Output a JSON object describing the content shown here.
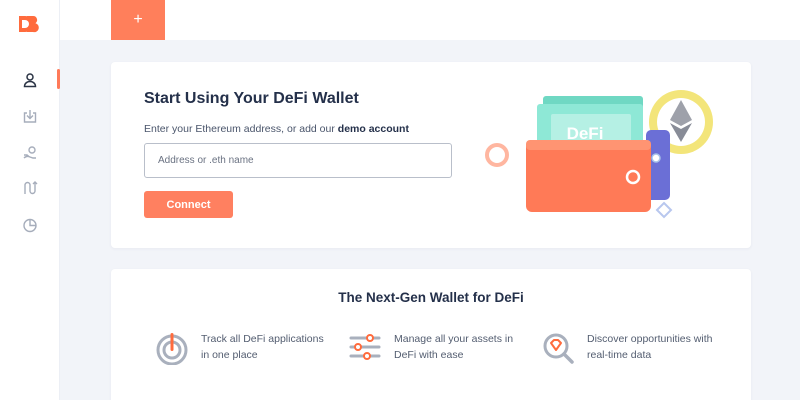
{
  "topbar": {
    "add_tab_label": "+"
  },
  "sidebar": {
    "items": [
      {
        "icon": "user-icon",
        "active": true
      },
      {
        "icon": "download-icon",
        "active": false
      },
      {
        "icon": "coins-icon",
        "active": false
      },
      {
        "icon": "route-icon",
        "active": false
      },
      {
        "icon": "pie-chart-icon",
        "active": false
      }
    ]
  },
  "connect": {
    "title": "Start Using Your DeFi Wallet",
    "subtitle": "Enter your Ethereum address, or add our",
    "demo_link": "demo account",
    "input_placeholder": "Address or .eth name",
    "input_value": "",
    "button_label": "Connect",
    "illustration_badge": "DeFi"
  },
  "features": {
    "title": "The Next-Gen Wallet for DeFi",
    "items": [
      {
        "icon": "target-icon",
        "text": "Track all DeFi applications in one place"
      },
      {
        "icon": "sliders-icon",
        "text": "Manage all your assets in DeFi with ease"
      },
      {
        "icon": "magnifier-diamond-icon",
        "text": "Discover opportunities with real-time data"
      }
    ]
  },
  "colors": {
    "accent": "#ff7f5b",
    "background": "#f2f4f9",
    "teal": "#7fe3cf",
    "gold": "#f3e57a",
    "purple": "#6b6fd6"
  }
}
